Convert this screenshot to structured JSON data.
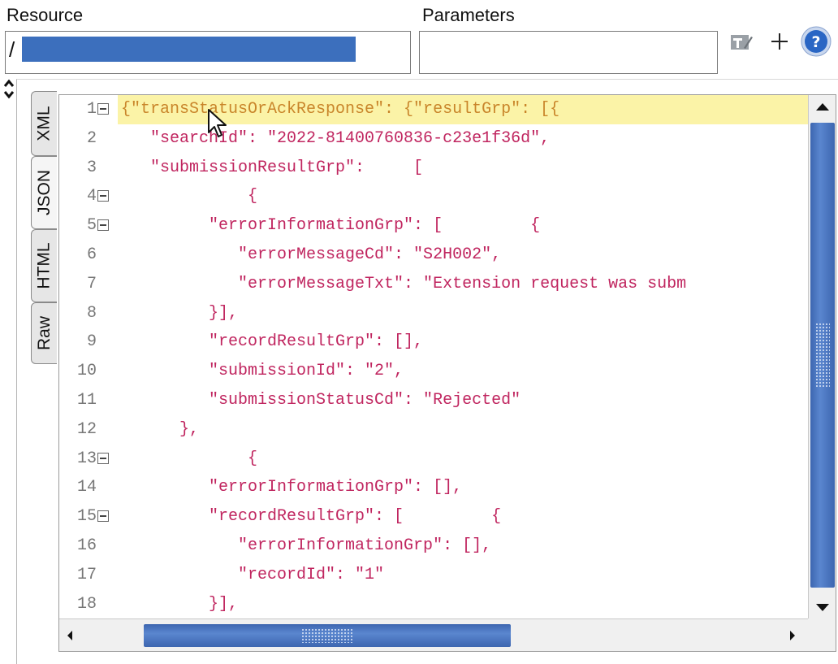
{
  "resource": {
    "label": "Resource",
    "value": "/"
  },
  "parameters": {
    "label": "Parameters",
    "value": ""
  },
  "toolbar": {
    "icons": [
      "auto-format-icon",
      "add-icon",
      "help-icon"
    ],
    "help_color": "#2a66c4"
  },
  "tabs": [
    {
      "label": "XML",
      "active": false
    },
    {
      "label": "JSON",
      "active": true
    },
    {
      "label": "HTML",
      "active": false
    },
    {
      "label": "Raw",
      "active": false
    }
  ],
  "editor": {
    "colors": {
      "key": "#c0255f",
      "punct": "#e04848",
      "highlight": "#fbf3a7"
    },
    "lines": [
      {
        "n": "1",
        "text": "{\"transStatusOrAckResponse\": {\"resultGrp\": [{",
        "fold": true
      },
      {
        "n": "2",
        "text": "   \"searchId\": \"2022-81400760836-c23e1f36d\",",
        "fold": false
      },
      {
        "n": "3",
        "text": "   \"submissionResultGrp\":     [",
        "fold": false
      },
      {
        "n": "4",
        "text": "             {",
        "fold": true
      },
      {
        "n": "5",
        "text": "         \"errorInformationGrp\": [         {",
        "fold": true
      },
      {
        "n": "6",
        "text": "            \"errorMessageCd\": \"S2H002\",",
        "fold": false
      },
      {
        "n": "7",
        "text": "            \"errorMessageTxt\": \"Extension request was subm",
        "fold": false
      },
      {
        "n": "8",
        "text": "         }],",
        "fold": false
      },
      {
        "n": "9",
        "text": "         \"recordResultGrp\": [],",
        "fold": false
      },
      {
        "n": "10",
        "text": "         \"submissionId\": \"2\",",
        "fold": false
      },
      {
        "n": "11",
        "text": "         \"submissionStatusCd\": \"Rejected\"",
        "fold": false
      },
      {
        "n": "12",
        "text": "      },",
        "fold": false
      },
      {
        "n": "13",
        "text": "             {",
        "fold": true
      },
      {
        "n": "14",
        "text": "         \"errorInformationGrp\": [],",
        "fold": false
      },
      {
        "n": "15",
        "text": "         \"recordResultGrp\": [         {",
        "fold": true
      },
      {
        "n": "16",
        "text": "            \"errorInformationGrp\": [],",
        "fold": false
      },
      {
        "n": "17",
        "text": "            \"recordId\": \"1\"",
        "fold": false
      },
      {
        "n": "18",
        "text": "         }],",
        "fold": false
      }
    ]
  }
}
